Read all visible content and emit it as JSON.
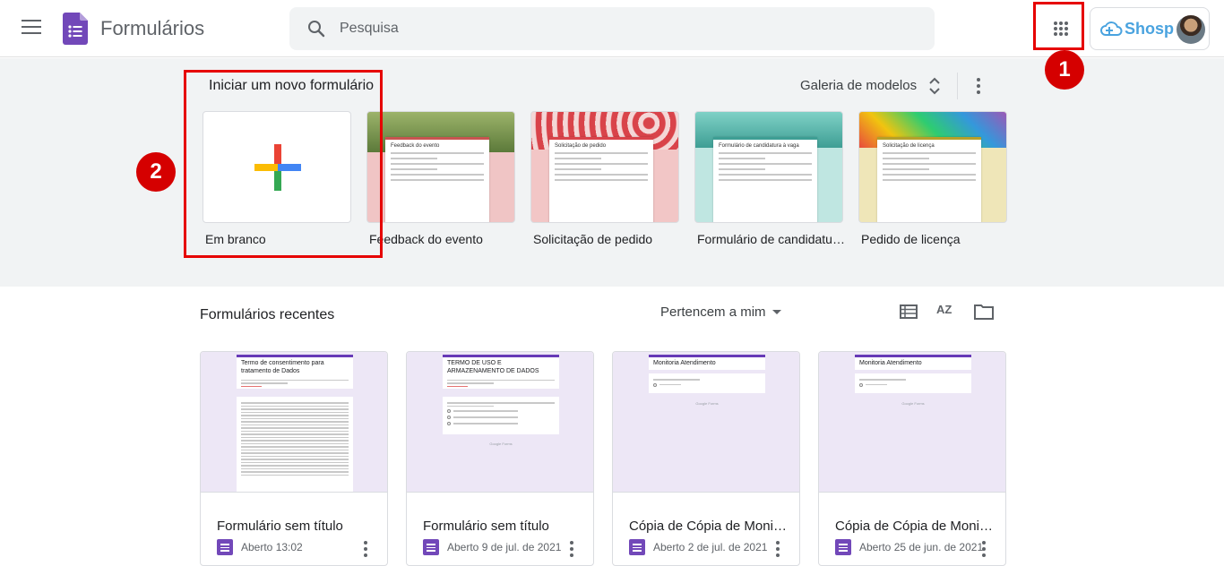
{
  "header": {
    "app_title": "Formulários",
    "search_placeholder": "Pesquisa",
    "account_brand": "Shosp"
  },
  "annotations": [
    {
      "number": "1",
      "target": "google-apps-button"
    },
    {
      "number": "2",
      "target": "blank-form-template"
    }
  ],
  "gallery": {
    "heading": "Iniciar um novo formulário",
    "gallery_link": "Galeria de modelos",
    "templates": [
      {
        "label": "Em branco"
      },
      {
        "label": "Feedback do evento",
        "card_title": "Feedback do evento"
      },
      {
        "label": "Solicitação de pedido",
        "card_title": "Solicitação de pedido"
      },
      {
        "label": "Formulário de candidatura a vaga",
        "card_title": "Formulário de candidatura à vaga"
      },
      {
        "label": "Pedido de licença",
        "card_title": "Solicitação de licença"
      }
    ]
  },
  "recent": {
    "title": "Formulários recentes",
    "owner_filter": "Pertencem a mim",
    "sort_label": "AZ",
    "docs": [
      {
        "name": "Formulário sem título",
        "opened": "Aberto 13:02",
        "thumb_title": "Termo de consentimento para tratamento de Dados"
      },
      {
        "name": "Formulário sem título",
        "opened": "Aberto 9 de jul. de 2021",
        "thumb_title": "TERMO DE USO E ARMAZENAMENTO DE DADOS"
      },
      {
        "name": "Cópia de Cópia de Monitoria Atendimento",
        "opened": "Aberto 2 de jul. de 2021",
        "thumb_title": "Monitoria Atendimento"
      },
      {
        "name": "Cópia de Cópia de Monitoria Atendimento",
        "opened": "Aberto 25 de jun. de 2021",
        "thumb_title": "Monitoria Atendimento"
      }
    ],
    "thumb_footer": "Google Forms"
  },
  "colors": {
    "forms_purple": "#673ab7",
    "annotation_red": "#e60000",
    "gallery_bg": "#f1f3f4"
  }
}
